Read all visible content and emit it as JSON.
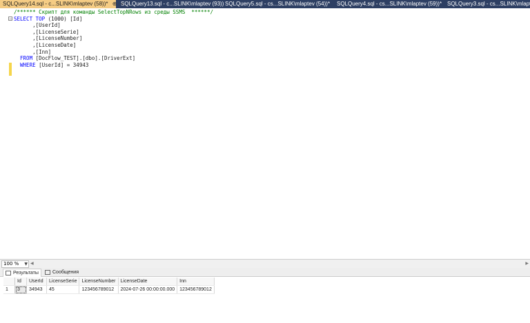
{
  "tabs": [
    {
      "label": "SQLQuery14.sql - c...SLINK\\mlaptev (58))*",
      "pin": "⊕",
      "close": "×"
    },
    {
      "label": "SQLQuery13.sql - c...SLINK\\mlaptev (93))"
    },
    {
      "label": "SQLQuery5.sql - cs...SLINK\\mlaptev (54))*"
    },
    {
      "label": "SQLQuery4.sql - cs...SLINK\\mlaptev (59))*"
    },
    {
      "label": "SQLQuery3.sql - cs...SLINK\\mlaptev (6"
    }
  ],
  "editor": {
    "comment": "/****** Скрипт для команды SelectTopNRows из среды SSMS  ******/",
    "select_kw": "SELECT",
    "top_kw": "TOP",
    "top_val": "(1000) [Id]",
    "cols": [
      ",[UserId]",
      ",[LicenseSerie]",
      ",[LicenseNumber]",
      ",[LicenseDate]",
      ",[Inn]"
    ],
    "from_kw": "FROM",
    "from_val": "[DocFlow_TEST].[dbo].[DriverExt]",
    "where_kw": "WHERE",
    "where_val": "[UserId] = 34943"
  },
  "zoom": {
    "value": "100 %"
  },
  "results": {
    "tab_results": "Результаты",
    "tab_messages": "Сообщения",
    "columns": [
      "Id",
      "UserId",
      "LicenseSerie",
      "LicenseNumber",
      "LicenseDate",
      "Inn"
    ],
    "rows": [
      {
        "num": "1",
        "cells": [
          "3",
          "34943",
          "45",
          "123456789012",
          "2024-07-26 00:00:00.000",
          "123456789012"
        ]
      }
    ]
  }
}
